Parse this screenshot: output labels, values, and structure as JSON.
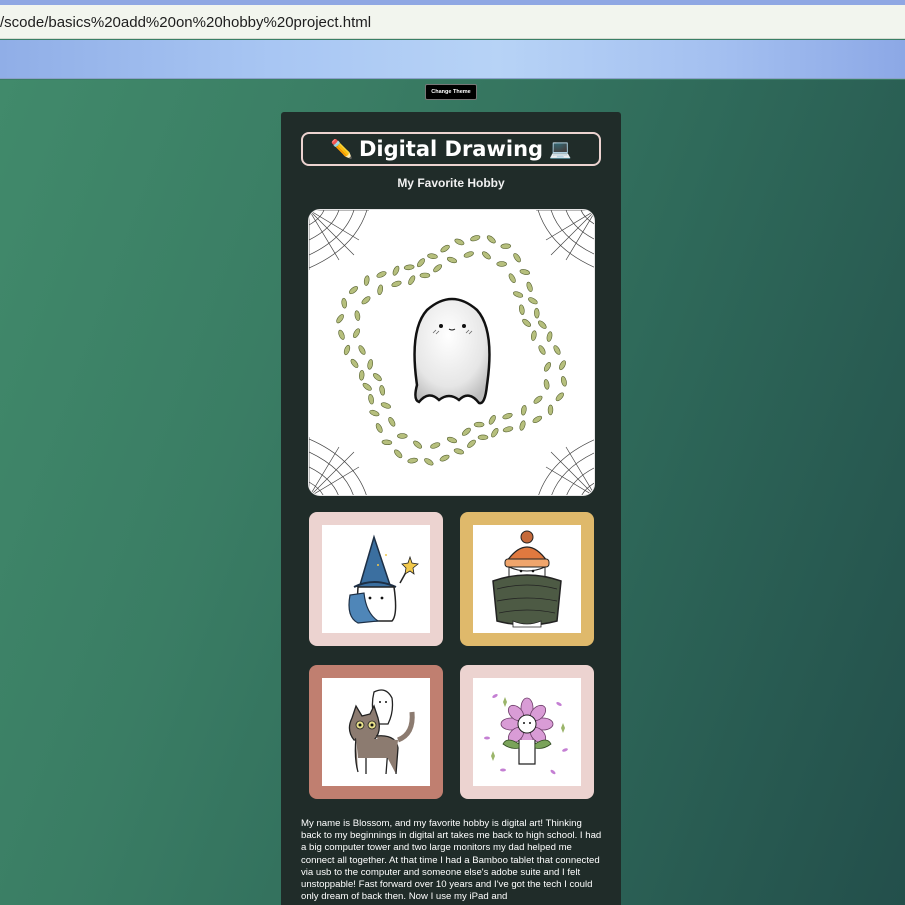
{
  "browser": {
    "address": "/scode/basics%20add%20on%20hobby%20project.html"
  },
  "page": {
    "theme_button": "Change Theme",
    "title_emoji_left": "✏️",
    "title": "Digital Drawing",
    "title_emoji_right": "💻",
    "subtitle": "My Favorite Hobby",
    "colors": {
      "panel": "#202c29",
      "title_border": "#ecd3d0",
      "thumb_pink": "#ecd3d0",
      "thumb_gold": "#dfb96b",
      "thumb_rose": "#c07f70",
      "thumb_blush": "#ecd3d0"
    },
    "bio": "My name is Blossom, and my favorite hobby is digital art! Thinking back to my beginnings in digital art takes me back to high school. I had a big computer tower and two large monitors my dad helped me connect all together. At that time I had a Bamboo tablet that connected via usb to the computer and someone else's adobe suite and I felt unstoppable! Fast forward over 10 years and I've got the tech I could only dream of back then. Now I use my iPad and"
  }
}
